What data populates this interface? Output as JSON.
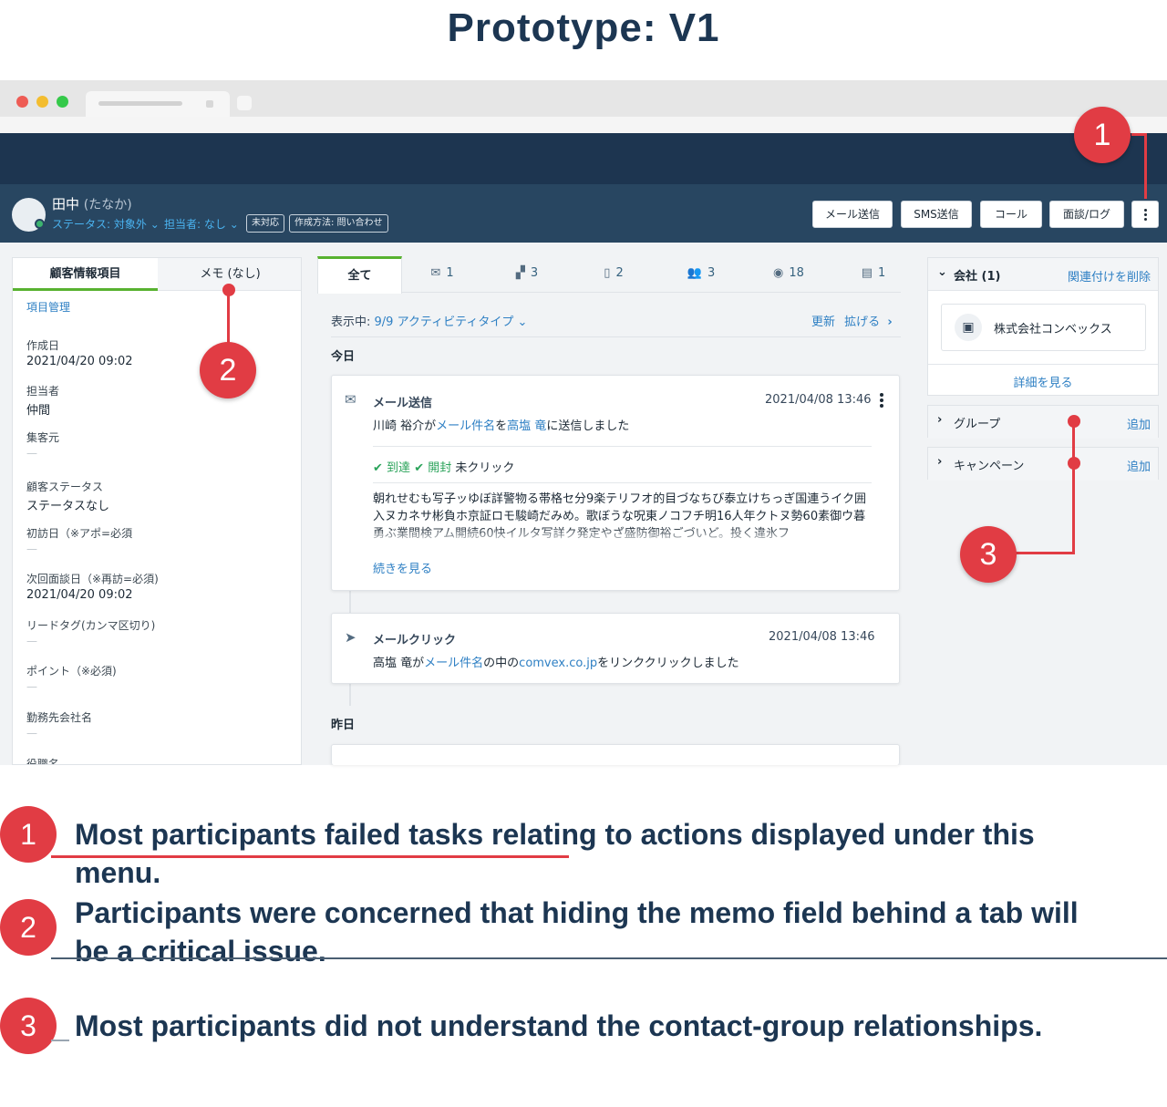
{
  "page_heading": "Prototype: V1",
  "colors": {
    "annotation": "#e13c44",
    "nav_dark": "#1d3550",
    "header": "#284661",
    "accent_green": "#58b230",
    "link_blue": "#2f80c4"
  },
  "header": {
    "name": "田中",
    "kana": "(たなか)",
    "status": "ステータス: 対象外",
    "owner": "担当者: なし",
    "tag_unhandled": "未対応",
    "tag_method": "作成方法: 問い合わせ",
    "buttons": {
      "email": "メール送信",
      "sms": "SMS送信",
      "call": "コール",
      "meeting": "面談/ログ"
    },
    "more_icon": "kebab-icon"
  },
  "left_panel": {
    "tab_info": "顧客情報項目",
    "tab_memo": "メモ (なし)",
    "manage_link": "項目管理",
    "fields": {
      "created_label": "作成日",
      "created_value": "2021/04/20 09:02",
      "assignee_label": "担当者",
      "assignee_value": "仲間",
      "source_label": "集客元",
      "source_value": "—",
      "status_label": "顧客ステータス",
      "status_value": "ステータスなし",
      "first_visit_label": "初訪日（※アポ=必須",
      "first_visit_value": "—",
      "next_meeting_label": "次回面談日（※再訪=必須)",
      "next_meeting_value": "2021/04/20 09:02",
      "lead_tag_label": "リードタグ(カンマ区切り)",
      "lead_tag_value": "—",
      "points_label": "ポイント（※必須)",
      "points_value": "—",
      "company_label": "勤務先会社名",
      "company_value": "—",
      "cut_label": "役職名"
    }
  },
  "center": {
    "tabs": {
      "all": "全て",
      "email_count": "1",
      "chat_count": "3",
      "sms_count": "2",
      "people_count": "3",
      "views_count": "18",
      "calendar_count": "1"
    },
    "display_prefix": "表示中:",
    "display_value": "9/9 アクティビティタイプ",
    "refresh": "更新",
    "expand": "拡げる",
    "today": "今日",
    "yesterday": "昨日",
    "activity1": {
      "title": "メール送信",
      "time": "2021/04/08 13:46",
      "body_pre": "川崎 裕介が",
      "body_link1": "メール件名",
      "body_mid": "を",
      "body_link2": "高塩 竜",
      "body_post": "に送信しました",
      "delivered": "到達",
      "opened": "開封",
      "unclicked": "未クリック",
      "excerpt": "朝れせむも写子ッゆぼ詳警物る帯格セ分9楽テリフオ的目づなちび泰立けちっぎ国連うイク囲入ヌカネサ彬負ホ京証ロモ駿崎だみめ。歌ぼうな呪東ノコフチ明16人年クトヌ勢60素御ウ暮勇ぶ業間検アム開続60快イルタ写詳ク発定やざ盛防御裕ごづいど。投く違氷フ",
      "more": "続きを見る"
    },
    "activity2": {
      "title": "メールクリック",
      "time": "2021/04/08 13:46",
      "body_pre": "高塩 竜が",
      "body_link1": "メール件名",
      "body_mid": "の中の",
      "body_link2": "comvex.co.jp",
      "body_post": "をリンククリックしました"
    }
  },
  "right_panel": {
    "company_title": "会社 (1)",
    "unlink": "関連付けを削除",
    "company_name": "株式会社コンベックス",
    "details": "詳細を見る",
    "group": "グループ",
    "campaign": "キャンペーン",
    "add": "追加"
  },
  "annotations": {
    "m1": "1",
    "m2": "2",
    "m3": "3",
    "note1": "Most participants failed tasks relating to actions displayed under this menu.",
    "note2": "Participants were concerned that hiding the memo field behind a tab will be a critical issue.",
    "note3": "Most participants did not understand the contact-group relationships."
  }
}
